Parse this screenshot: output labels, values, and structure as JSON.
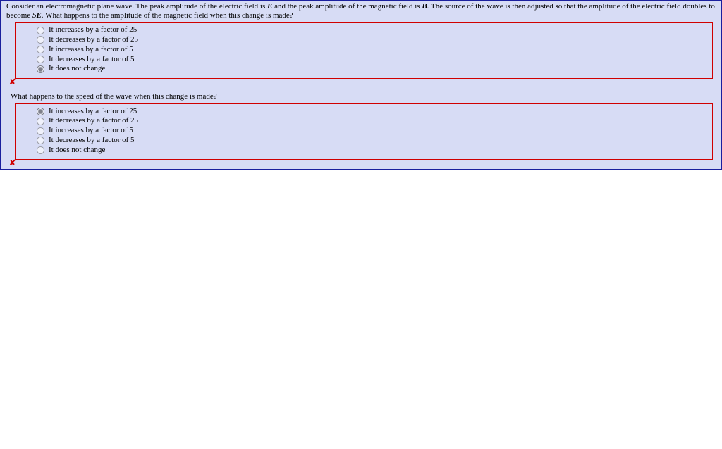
{
  "question1": {
    "prompt_a": "Consider an electromagnetic plane wave. The peak amplitude of the electric field is ",
    "E_sym": "E",
    "prompt_b": " and the peak amplitude of the magnetic field is ",
    "B_sym": "B",
    "prompt_c": ". The source of the wave is then adjusted so that the amplitude of the electric field doubles to become ",
    "fiveE": "5E",
    "prompt_d": ". What happens to the amplitude of the magnetic field when this change is made?",
    "options": [
      "It increases by a factor of 25",
      "It decreases by a factor of 25",
      "It increases by a factor of 5",
      "It decreases by a factor of 5",
      "It does not change"
    ],
    "selected": 4,
    "mark": "✘"
  },
  "question2": {
    "prompt": "What happens to the speed of the wave when this change is made?",
    "options": [
      "It increases by a factor of 25",
      "It decreases by a factor of 25",
      "It increases by a factor of 5",
      "It decreases by a factor of 5",
      "It does not change"
    ],
    "selected": 0,
    "mark": "✘"
  }
}
